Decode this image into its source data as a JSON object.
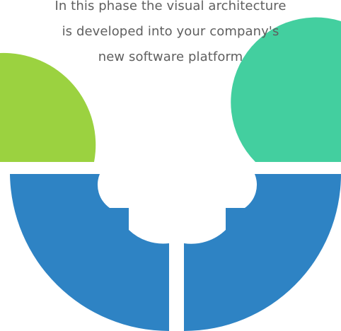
{
  "caption": {
    "lines": [
      "In this phase the visual architecture",
      "is developed into your company's",
      "new software platform"
    ]
  },
  "colors": {
    "lime": "#9bd240",
    "teal": "#43cf9f",
    "blue": "#2e83c4",
    "text": "#5f5f5f",
    "background": "#ffffff"
  }
}
